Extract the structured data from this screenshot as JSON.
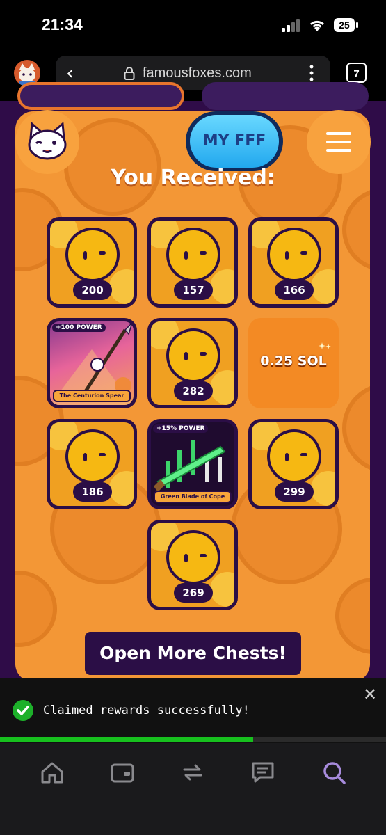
{
  "status_bar": {
    "time": "21:34",
    "battery": "25"
  },
  "browser": {
    "url": "famousfoxes.com",
    "tab_count": "7"
  },
  "header": {
    "my_button": "MY FFF"
  },
  "main": {
    "heading": "You Received:",
    "rewards": [
      {
        "type": "coin",
        "value": "200"
      },
      {
        "type": "coin",
        "value": "157"
      },
      {
        "type": "coin",
        "value": "166"
      },
      {
        "type": "item",
        "badge": "+100 POWER",
        "name": "The Centurion Spear"
      },
      {
        "type": "coin",
        "value": "282"
      },
      {
        "type": "sol",
        "value": "0.25 SOL"
      },
      {
        "type": "coin",
        "value": "186"
      },
      {
        "type": "item",
        "badge": "+15% POWER",
        "name": "Green Blade of Cope"
      },
      {
        "type": "coin",
        "value": "299"
      },
      {
        "type": "coin",
        "value": "269"
      }
    ],
    "open_more_button": "Open More Chests!"
  },
  "toast": {
    "message": "Claimed rewards successfully!",
    "progress": 0.655
  },
  "bottom_nav": {
    "icons": [
      "home-icon",
      "wallet-icon",
      "swap-icon",
      "messages-icon",
      "search-icon"
    ],
    "active": "search-icon"
  },
  "colors": {
    "panel": "#f39736",
    "page_bg": "#2f0c48",
    "dark_purple": "#2b0e46",
    "toast_green": "#17c01e",
    "nav_active": "#a78bdc"
  }
}
